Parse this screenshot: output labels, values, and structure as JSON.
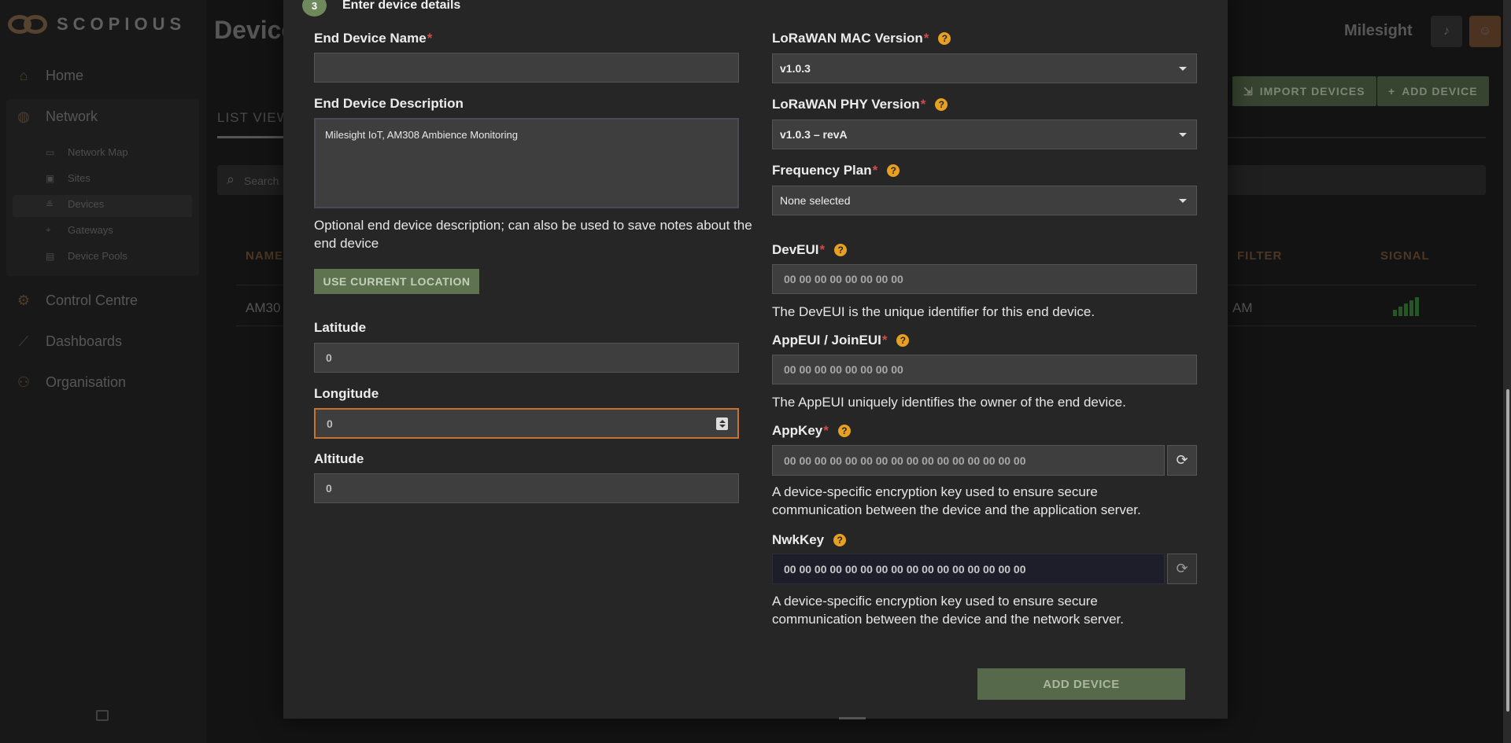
{
  "app": {
    "logo_text": "SCOPIOUS",
    "page_title": "Devices",
    "org_name": "Milesight"
  },
  "sidebar": {
    "items": [
      {
        "label": "Home",
        "icon": "home-icon"
      },
      {
        "label": "Network",
        "icon": "globe-icon"
      },
      {
        "label": "Control Centre",
        "icon": "control-centre-icon"
      },
      {
        "label": "Dashboards",
        "icon": "chart-line-icon"
      },
      {
        "label": "Organisation",
        "icon": "users-icon"
      }
    ],
    "network_sub": [
      {
        "label": "Network Map",
        "icon": "map-icon"
      },
      {
        "label": "Sites",
        "icon": "building-icon"
      },
      {
        "label": "Devices",
        "icon": "device-icon"
      },
      {
        "label": "Gateways",
        "icon": "antenna-icon"
      },
      {
        "label": "Device Pools",
        "icon": "pool-icon"
      }
    ]
  },
  "background": {
    "import_devices": "IMPORT DEVICES",
    "add_device": "ADD DEVICE",
    "tab_list_view": "LIST VIEW",
    "search_placeholder": "Search",
    "col_name": "NAME",
    "col_filter": "FILTER",
    "col_signal": "SIGNAL",
    "row_name": "AM30",
    "row_time": "AM"
  },
  "modal": {
    "step_number": "3",
    "step_title": "Enter device details",
    "left": {
      "name_label": "End Device Name",
      "name_value": "",
      "description_label": "End Device Description",
      "description_value": "Milesight IoT, AM308 Ambience Monitoring",
      "description_hint": "Optional end device description; can also be used to save notes about the end device",
      "use_location_button": "USE CURRENT LOCATION",
      "latitude_label": "Latitude",
      "latitude_value": "0",
      "longitude_label": "Longitude",
      "longitude_value": "0",
      "altitude_label": "Altitude",
      "altitude_value": "0"
    },
    "right": {
      "mac_label": "LoRaWAN MAC Version",
      "mac_value": "v1.0.3",
      "phy_label": "LoRaWAN PHY Version",
      "phy_value": "v1.0.3 – revA",
      "freq_label": "Frequency Plan",
      "freq_value": "None selected",
      "deveui_label": "DevEUI",
      "deveui_placeholder": "00 00 00 00 00 00 00 00",
      "deveui_hint": "The DevEUI is the unique identifier for this end device.",
      "appeui_label": "AppEUI / JoinEUI",
      "appeui_placeholder": "00 00 00 00 00 00 00 00",
      "appeui_hint": "The AppEUI uniquely identifies the owner of the end device.",
      "appkey_label": "AppKey",
      "appkey_placeholder": "00 00 00 00 00 00 00 00 00 00 00 00 00 00 00 00",
      "appkey_hint": "A device-specific encryption key used to ensure secure communication between the device and the application server.",
      "nwkkey_label": "NwkKey",
      "nwkkey_value": "00 00 00 00 00 00 00 00 00 00 00 00 00 00 00 00",
      "nwkkey_hint": "A device-specific encryption key used to ensure secure communication between the device and the network server."
    },
    "submit_button": "ADD DEVICE",
    "required_mark": "*",
    "help_glyph": "?"
  }
}
